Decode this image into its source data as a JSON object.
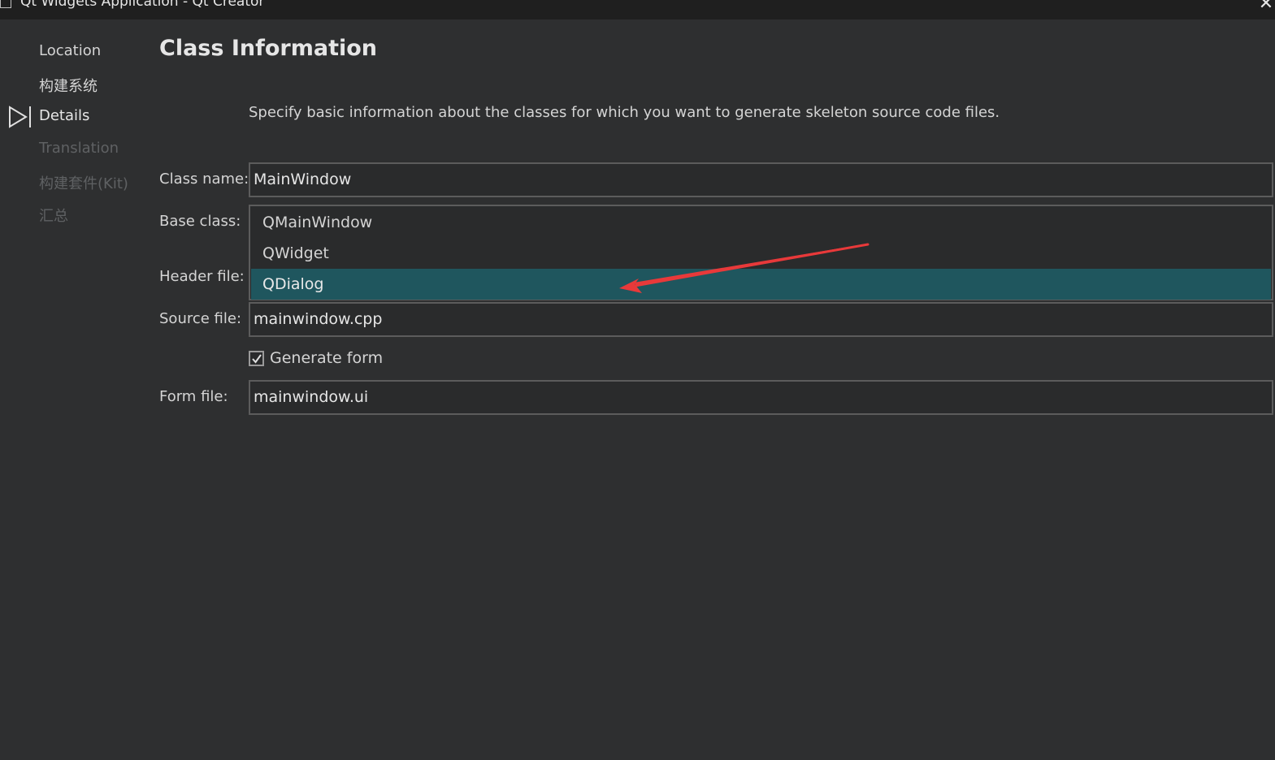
{
  "window": {
    "title": "Qt Widgets Application - Qt Creator",
    "close_glyph": "✕"
  },
  "sidebar": {
    "items": [
      {
        "label": "Location",
        "state": "done"
      },
      {
        "label": "构建系统",
        "state": "done"
      },
      {
        "label": "Details",
        "state": "active"
      },
      {
        "label": "Translation",
        "state": "pending"
      },
      {
        "label": "构建套件(Kit)",
        "state": "pending"
      },
      {
        "label": "汇总",
        "state": "pending"
      }
    ]
  },
  "page": {
    "title": "Class Information",
    "description": "Specify basic information about the classes for which you want to generate skeleton source code files."
  },
  "form": {
    "class_name_label": "Class name:",
    "class_name_value": "MainWindow",
    "base_class_label": "Base class:",
    "base_class_options": [
      "QMainWindow",
      "QWidget",
      "QDialog"
    ],
    "base_class_highlighted": "QDialog",
    "header_file_label": "Header file:",
    "source_file_label": "Source file:",
    "source_file_value": "mainwindow.cpp",
    "generate_form_label": "Generate form",
    "generate_form_checked": true,
    "form_file_label": "Form file:",
    "form_file_value": "mainwindow.ui"
  },
  "colors": {
    "background": "#2e2f30",
    "highlight": "#1f565e",
    "annotation_arrow": "#e8393a"
  }
}
